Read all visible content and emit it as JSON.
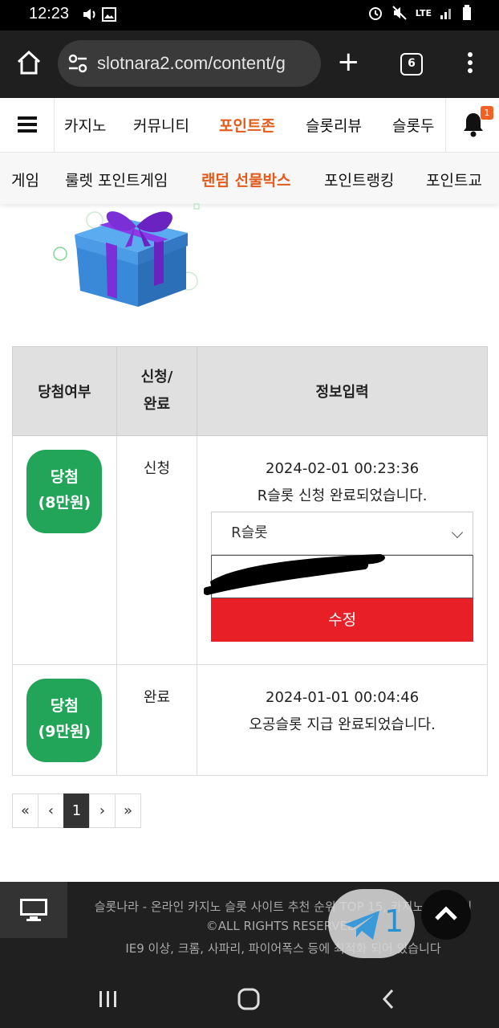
{
  "status_bar": {
    "time": "12:23",
    "network": "LTE"
  },
  "browser": {
    "url": "slotnara2.com/content/g",
    "tab_count": "6"
  },
  "nav": {
    "items": [
      "카지노",
      "커뮤니티",
      "포인트존",
      "슬롯리뷰",
      "슬롯두"
    ],
    "active": "포인트존",
    "notification_count": "1"
  },
  "subnav": {
    "items": [
      "게임",
      "룰렛 포인트게임",
      "랜덤 선물박스",
      "포인트랭킹",
      "포인트교"
    ],
    "active": "랜덤 선물박스"
  },
  "table": {
    "headers": {
      "result": "당첨여부",
      "status_line1": "신청/",
      "status_line2": "완료",
      "info": "정보입력"
    },
    "rows": [
      {
        "badge_line1": "당첨",
        "badge_line2": "(8만원)",
        "status": "신청",
        "datetime": "2024-02-01 00:23:36",
        "message": "R슬롯 신청 완료되었습니다.",
        "select_value": "R슬롯",
        "edit_label": "수정"
      },
      {
        "badge_line1": "당첨",
        "badge_line2": "(9만원)",
        "status": "완료",
        "datetime": "2024-01-01 00:04:46",
        "message": "오공슬롯 지급 완료되었습니다."
      }
    ]
  },
  "pagination": {
    "first": "«",
    "prev": "‹",
    "current": "1",
    "next": "›",
    "last": "»"
  },
  "footer": {
    "line1": "슬롯나라 - 온라인 카지노 슬롯 사이트 추천 순위 TOP 15, 카지노 커뮤니티",
    "line2": "©ALL RIGHTS RESERVED.",
    "line3": "IE9 이상, 크롬, 사파리, 파이어폭스 등에 최적화 되어 있습니다",
    "telegram_count": "1"
  },
  "colors": {
    "accent_orange": "#e35a1a",
    "badge_green": "#22a558",
    "button_red": "#e81f26"
  },
  "icons": {
    "gift": "gift-box-icon",
    "telegram": "telegram-icon",
    "scroll_top": "chevron-up-icon"
  }
}
